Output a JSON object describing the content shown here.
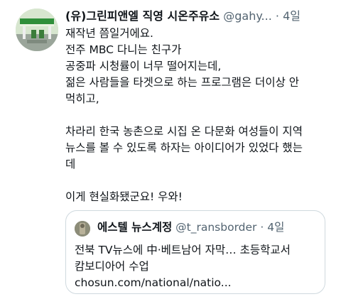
{
  "author": {
    "name": "(유)그린피앤엘 직영 시온주유소",
    "handle": "@gahy...",
    "dot": "·",
    "time": "4일"
  },
  "tweet_lines": [
    "재작년 쯤일거에요.",
    "전주 MBC 다니는 친구가",
    "공중파 시청률이 너무 떨어지는데,",
    "젊은 사람들을 타겟으로 하는 프로그램은 더이상 안",
    "먹히고,",
    "",
    "차라리 한국 농촌으로 시집 온 다문화 여성들이 지역",
    "뉴스를 볼 수 있도록 하자는 아이디어가 있었다 했는",
    "데",
    "",
    "이게 현실화됐군요! 우와!"
  ],
  "quoted": {
    "name": "에스텔 뉴스계정",
    "handle": "@t_ransborder",
    "dot": "·",
    "time": "4일",
    "lines": [
      "전북 TV뉴스에 中·베트남어 자막… 초등학교서",
      "캄보디아어 수업"
    ],
    "link": "chosun.com/national/natio..."
  }
}
